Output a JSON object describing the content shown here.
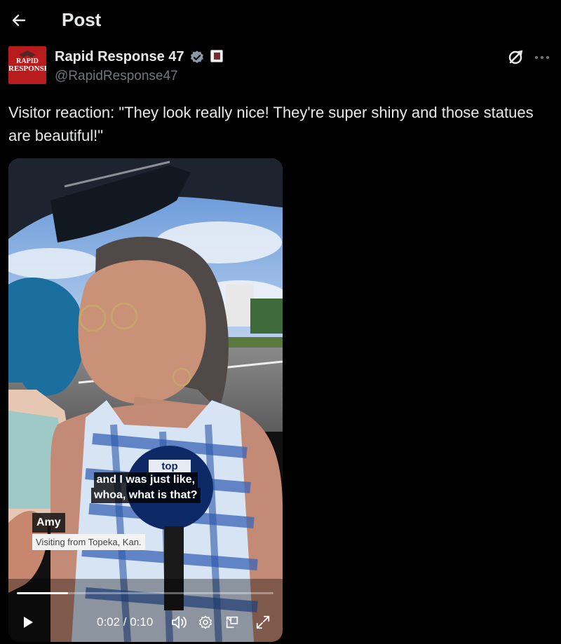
{
  "header": {
    "title": "Post",
    "back_icon": "arrow-left-icon"
  },
  "author": {
    "display_name": "Rapid Response 47",
    "handle": "@RapidResponse47",
    "avatar_text_line1": "RAPID",
    "avatar_text_line2": "RESPONSE",
    "verified_icon": "verified-badge-icon",
    "affiliation_icon": "affiliation-badge-icon"
  },
  "tweet": {
    "text": "Visitor reaction: \"They look really nice! They're super shiny and those statues are beautiful!\""
  },
  "video": {
    "subtitle_line1": "and I was just like,",
    "subtitle_line2": "whoa, what is that?",
    "lower_third_name": "Amy",
    "lower_third_desc": "Visiting from Topeka, Kan.",
    "mic_text": "top",
    "time_display": "0:02 / 0:10",
    "progress": 0.2,
    "controls": [
      "play-icon",
      "volume-icon",
      "settings-icon",
      "picture-in-picture-icon",
      "fullscreen-icon"
    ]
  },
  "colors": {
    "background": "#000000",
    "text": "#e7e9ea",
    "secondary": "#71767b",
    "verified": "#8b98a5",
    "avatar_bg": "#b91c1c"
  }
}
